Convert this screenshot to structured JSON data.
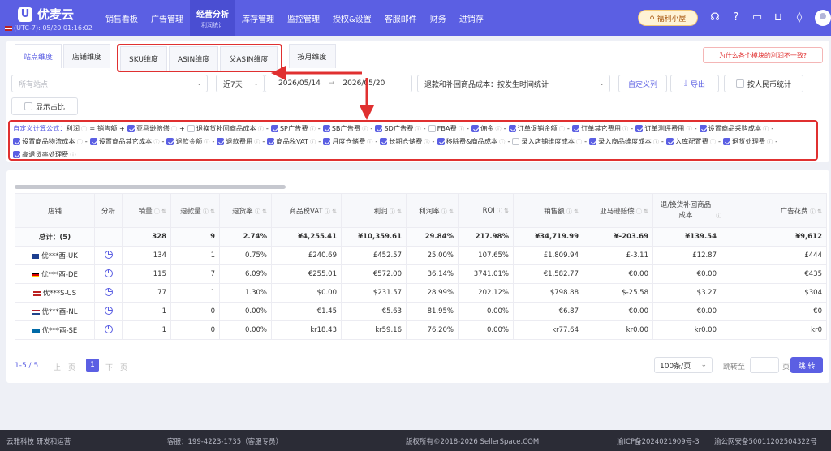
{
  "app": {
    "logo_mark": "U",
    "name": "优麦云",
    "timezone": "(UTC-7): 05/20 01:16:02"
  },
  "nav": [
    {
      "label": "销售看板",
      "sub": ""
    },
    {
      "label": "广告管理",
      "sub": ""
    },
    {
      "label": "经营分析",
      "sub": "利润统计"
    },
    {
      "label": "库存管理",
      "sub": ""
    },
    {
      "label": "监控管理",
      "sub": ""
    },
    {
      "label": "授权&设置",
      "sub": ""
    },
    {
      "label": "客服邮件",
      "sub": ""
    },
    {
      "label": "财务",
      "sub": ""
    },
    {
      "label": "进销存",
      "sub": ""
    }
  ],
  "welfare": "福利小屋",
  "tabs": {
    "site": "站点维度",
    "store": "店铺维度",
    "sku": "SKU维度",
    "asin": "ASIN维度",
    "parent_asin": "父ASIN维度",
    "month": "按月维度"
  },
  "profit_link": "为什么各个模块的利润不一致?",
  "filters": {
    "site_placeholder": "所有站点",
    "period": "近7天",
    "date_start": "2026/05/14",
    "date_sep": "→",
    "date_end": "2026/05/20",
    "cost_mode": "退款和补回商品成本：按发生时间统计",
    "custom_columns": "自定义列",
    "export": "导出",
    "rmb_label": "按人民币统计",
    "show_ratio": "显示占比"
  },
  "formula": {
    "label": "自定义计算公式：",
    "result": "利润",
    "eq": "= 销售额 +",
    "terms": [
      {
        "label": "亚马逊赔偿",
        "checked": true,
        "op": "+"
      },
      {
        "label": "退换货补回商品成本",
        "checked": false,
        "op": "-"
      },
      {
        "label": "SP广告费",
        "checked": true,
        "op": "-"
      },
      {
        "label": "SB广告费",
        "checked": true,
        "op": "-"
      },
      {
        "label": "SD广告费",
        "checked": true,
        "op": "-"
      },
      {
        "label": "FBA费",
        "checked": false,
        "op": "-"
      },
      {
        "label": "佣金",
        "checked": true,
        "op": "-"
      },
      {
        "label": "订单促销金额",
        "checked": true,
        "op": "-"
      },
      {
        "label": "订单其它费用",
        "checked": true,
        "op": "-"
      },
      {
        "label": "订单测评费用",
        "checked": true,
        "op": "-"
      },
      {
        "label": "设置商品采购成本",
        "checked": true,
        "op": "-"
      },
      {
        "label": "设置商品物流成本",
        "checked": true,
        "op": "-"
      },
      {
        "label": "设置商品其它成本",
        "checked": true,
        "op": "-"
      },
      {
        "label": "退款金额",
        "checked": true,
        "op": "-"
      },
      {
        "label": "退款费用",
        "checked": true,
        "op": "-"
      },
      {
        "label": "商品税VAT",
        "checked": true,
        "op": "-"
      },
      {
        "label": "月度仓储费",
        "checked": true,
        "op": "-"
      },
      {
        "label": "长期仓储费",
        "checked": true,
        "op": "-"
      },
      {
        "label": "移除费&商品成本",
        "checked": true,
        "op": "-"
      },
      {
        "label": "录入店铺维度成本",
        "checked": false,
        "op": "-"
      },
      {
        "label": "录入商品维度成本",
        "checked": true,
        "op": "-"
      },
      {
        "label": "入库配置费",
        "checked": true,
        "op": "-"
      },
      {
        "label": "退货处理费",
        "checked": true,
        "op": "-"
      },
      {
        "label": "高退货率处理费",
        "checked": true,
        "op": ""
      }
    ]
  },
  "table": {
    "headers": [
      "店铺",
      "分析",
      "销量",
      "退款量",
      "退货率",
      "商品税VAT",
      "利润",
      "利润率",
      "ROI",
      "销售额",
      "亚马逊赔偿",
      "退/换货补回商品成本",
      "广告花费"
    ],
    "total": [
      "总计：(5)",
      "",
      "328",
      "9",
      "2.74%",
      "¥4,255.41",
      "¥10,359.61",
      "29.84%",
      "217.98%",
      "¥34,719.99",
      "¥-203.69",
      "¥139.54",
      "¥9,612"
    ],
    "rows": [
      {
        "flag": "uk",
        "cells": [
          "优***酉-UK",
          "",
          "134",
          "1",
          "0.75%",
          "£240.69",
          "£452.57",
          "25.00%",
          "107.65%",
          "£1,809.94",
          "£-3.11",
          "£12.87",
          "£444"
        ]
      },
      {
        "flag": "de",
        "cells": [
          "优***酉-DE",
          "",
          "115",
          "7",
          "6.09%",
          "€255.01",
          "€572.00",
          "36.14%",
          "3741.01%",
          "€1,582.77",
          "€0.00",
          "€0.00",
          "€435"
        ]
      },
      {
        "flag": "us",
        "cells": [
          "优***S-US",
          "",
          "77",
          "1",
          "1.30%",
          "$0.00",
          "$231.57",
          "28.99%",
          "202.12%",
          "$798.88",
          "$-25.58",
          "$3.27",
          "$304"
        ]
      },
      {
        "flag": "nl",
        "cells": [
          "优***酉-NL",
          "",
          "1",
          "0",
          "0.00%",
          "€1.45",
          "€5.63",
          "81.95%",
          "0.00%",
          "€6.87",
          "€0.00",
          "€0.00",
          "€0"
        ]
      },
      {
        "flag": "se",
        "cells": [
          "优***酉-SE",
          "",
          "1",
          "0",
          "0.00%",
          "kr18.43",
          "kr59.16",
          "76.20%",
          "0.00%",
          "kr77.64",
          "kr0.00",
          "kr0.00",
          "kr0"
        ]
      }
    ]
  },
  "pager": {
    "info": "1-5 / 5",
    "prev": "上一页",
    "page": "1",
    "next": "下一页",
    "size": "100条/页",
    "jump": "跳转至",
    "unit": "页",
    "go": "跳 转"
  },
  "footer": {
    "left": "云雅科技 研发和运营",
    "phone": "客服：199-4223-1735（客服专员）",
    "copyright": "版权所有©2018-2026 SellerSpace.COM",
    "icp": "渝ICP备2024021909号-3",
    "police": "渝公网安备50011202504322号"
  },
  "colors": {
    "brand": "#5b5fe3",
    "annotation": "#e03030"
  }
}
